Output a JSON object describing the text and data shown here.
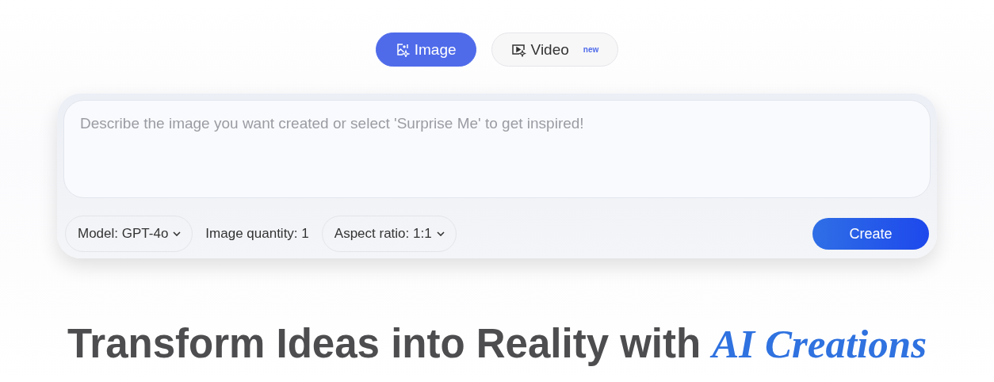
{
  "tabs": [
    {
      "kind": "image",
      "label": "Image",
      "selected": true
    },
    {
      "kind": "video",
      "label": "Video",
      "badge": "new",
      "selected": false
    }
  ],
  "prompt": {
    "placeholder": "Describe the image you want created or select 'Surprise Me' to get inspired!"
  },
  "options": [
    {
      "kind": "dropdown",
      "label": "Model:",
      "value": "GPT-4o"
    },
    {
      "kind": "text",
      "label": "Image quantity:",
      "value": "1"
    },
    {
      "kind": "dropdown",
      "label": "Aspect ratio:",
      "value": "1:1"
    }
  ],
  "create_button": "Create",
  "heading": "Transform Ideas into Reality with *AI Creations*"
}
